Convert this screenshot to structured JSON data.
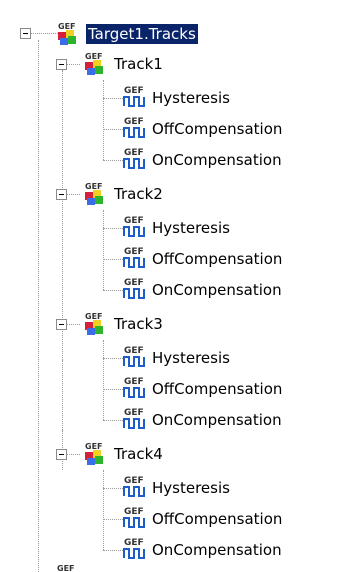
{
  "root": {
    "label": "Target1.Tracks",
    "icon": "gef-track-icon",
    "expanded": true,
    "selected": true
  },
  "icon_text": "GEF",
  "colors": {
    "selection_bg": "#0a246a",
    "selection_fg": "#ffffff",
    "tree_lines": "#9a9a9a",
    "gef_text": "#333333",
    "waveform": "#1e5cc8",
    "cube_red": "#d6203a",
    "cube_green": "#2db42d",
    "cube_blue": "#3a6ee8",
    "cube_yellow": "#f0d020"
  },
  "tracks": [
    {
      "label": "Track1",
      "expanded": true,
      "children": [
        {
          "label": "Hysteresis",
          "icon": "gef-waveform-icon"
        },
        {
          "label": "OffCompensation",
          "icon": "gef-waveform-icon"
        },
        {
          "label": "OnCompensation",
          "icon": "gef-waveform-icon"
        }
      ]
    },
    {
      "label": "Track2",
      "expanded": true,
      "children": [
        {
          "label": "Hysteresis",
          "icon": "gef-waveform-icon"
        },
        {
          "label": "OffCompensation",
          "icon": "gef-waveform-icon"
        },
        {
          "label": "OnCompensation",
          "icon": "gef-waveform-icon"
        }
      ]
    },
    {
      "label": "Track3",
      "expanded": true,
      "children": [
        {
          "label": "Hysteresis",
          "icon": "gef-waveform-icon"
        },
        {
          "label": "OffCompensation",
          "icon": "gef-waveform-icon"
        },
        {
          "label": "OnCompensation",
          "icon": "gef-waveform-icon"
        }
      ]
    },
    {
      "label": "Track4",
      "expanded": true,
      "children": [
        {
          "label": "Hysteresis",
          "icon": "gef-waveform-icon"
        },
        {
          "label": "OffCompensation",
          "icon": "gef-waveform-icon"
        },
        {
          "label": "OnCompensation",
          "icon": "gef-waveform-icon"
        }
      ]
    }
  ],
  "trailing_sibling": {
    "icon": "gef-icon"
  }
}
